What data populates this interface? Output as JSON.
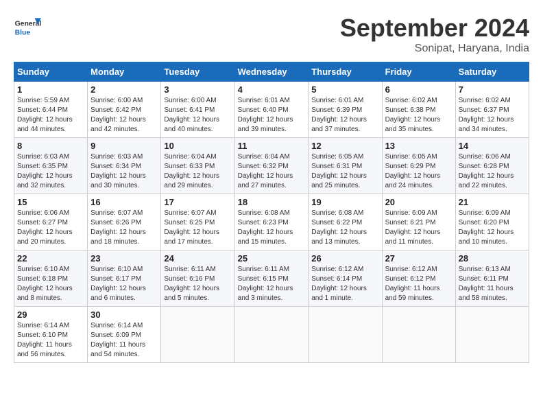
{
  "header": {
    "logo_general": "General",
    "logo_blue": "Blue",
    "month_title": "September 2024",
    "location": "Sonipat, Haryana, India"
  },
  "weekdays": [
    "Sunday",
    "Monday",
    "Tuesday",
    "Wednesday",
    "Thursday",
    "Friday",
    "Saturday"
  ],
  "weeks": [
    [
      {
        "day": "1",
        "sunrise": "Sunrise: 5:59 AM",
        "sunset": "Sunset: 6:44 PM",
        "daylight": "Daylight: 12 hours and 44 minutes."
      },
      {
        "day": "2",
        "sunrise": "Sunrise: 6:00 AM",
        "sunset": "Sunset: 6:42 PM",
        "daylight": "Daylight: 12 hours and 42 minutes."
      },
      {
        "day": "3",
        "sunrise": "Sunrise: 6:00 AM",
        "sunset": "Sunset: 6:41 PM",
        "daylight": "Daylight: 12 hours and 40 minutes."
      },
      {
        "day": "4",
        "sunrise": "Sunrise: 6:01 AM",
        "sunset": "Sunset: 6:40 PM",
        "daylight": "Daylight: 12 hours and 39 minutes."
      },
      {
        "day": "5",
        "sunrise": "Sunrise: 6:01 AM",
        "sunset": "Sunset: 6:39 PM",
        "daylight": "Daylight: 12 hours and 37 minutes."
      },
      {
        "day": "6",
        "sunrise": "Sunrise: 6:02 AM",
        "sunset": "Sunset: 6:38 PM",
        "daylight": "Daylight: 12 hours and 35 minutes."
      },
      {
        "day": "7",
        "sunrise": "Sunrise: 6:02 AM",
        "sunset": "Sunset: 6:37 PM",
        "daylight": "Daylight: 12 hours and 34 minutes."
      }
    ],
    [
      {
        "day": "8",
        "sunrise": "Sunrise: 6:03 AM",
        "sunset": "Sunset: 6:35 PM",
        "daylight": "Daylight: 12 hours and 32 minutes."
      },
      {
        "day": "9",
        "sunrise": "Sunrise: 6:03 AM",
        "sunset": "Sunset: 6:34 PM",
        "daylight": "Daylight: 12 hours and 30 minutes."
      },
      {
        "day": "10",
        "sunrise": "Sunrise: 6:04 AM",
        "sunset": "Sunset: 6:33 PM",
        "daylight": "Daylight: 12 hours and 29 minutes."
      },
      {
        "day": "11",
        "sunrise": "Sunrise: 6:04 AM",
        "sunset": "Sunset: 6:32 PM",
        "daylight": "Daylight: 12 hours and 27 minutes."
      },
      {
        "day": "12",
        "sunrise": "Sunrise: 6:05 AM",
        "sunset": "Sunset: 6:31 PM",
        "daylight": "Daylight: 12 hours and 25 minutes."
      },
      {
        "day": "13",
        "sunrise": "Sunrise: 6:05 AM",
        "sunset": "Sunset: 6:29 PM",
        "daylight": "Daylight: 12 hours and 24 minutes."
      },
      {
        "day": "14",
        "sunrise": "Sunrise: 6:06 AM",
        "sunset": "Sunset: 6:28 PM",
        "daylight": "Daylight: 12 hours and 22 minutes."
      }
    ],
    [
      {
        "day": "15",
        "sunrise": "Sunrise: 6:06 AM",
        "sunset": "Sunset: 6:27 PM",
        "daylight": "Daylight: 12 hours and 20 minutes."
      },
      {
        "day": "16",
        "sunrise": "Sunrise: 6:07 AM",
        "sunset": "Sunset: 6:26 PM",
        "daylight": "Daylight: 12 hours and 18 minutes."
      },
      {
        "day": "17",
        "sunrise": "Sunrise: 6:07 AM",
        "sunset": "Sunset: 6:25 PM",
        "daylight": "Daylight: 12 hours and 17 minutes."
      },
      {
        "day": "18",
        "sunrise": "Sunrise: 6:08 AM",
        "sunset": "Sunset: 6:23 PM",
        "daylight": "Daylight: 12 hours and 15 minutes."
      },
      {
        "day": "19",
        "sunrise": "Sunrise: 6:08 AM",
        "sunset": "Sunset: 6:22 PM",
        "daylight": "Daylight: 12 hours and 13 minutes."
      },
      {
        "day": "20",
        "sunrise": "Sunrise: 6:09 AM",
        "sunset": "Sunset: 6:21 PM",
        "daylight": "Daylight: 12 hours and 11 minutes."
      },
      {
        "day": "21",
        "sunrise": "Sunrise: 6:09 AM",
        "sunset": "Sunset: 6:20 PM",
        "daylight": "Daylight: 12 hours and 10 minutes."
      }
    ],
    [
      {
        "day": "22",
        "sunrise": "Sunrise: 6:10 AM",
        "sunset": "Sunset: 6:18 PM",
        "daylight": "Daylight: 12 hours and 8 minutes."
      },
      {
        "day": "23",
        "sunrise": "Sunrise: 6:10 AM",
        "sunset": "Sunset: 6:17 PM",
        "daylight": "Daylight: 12 hours and 6 minutes."
      },
      {
        "day": "24",
        "sunrise": "Sunrise: 6:11 AM",
        "sunset": "Sunset: 6:16 PM",
        "daylight": "Daylight: 12 hours and 5 minutes."
      },
      {
        "day": "25",
        "sunrise": "Sunrise: 6:11 AM",
        "sunset": "Sunset: 6:15 PM",
        "daylight": "Daylight: 12 hours and 3 minutes."
      },
      {
        "day": "26",
        "sunrise": "Sunrise: 6:12 AM",
        "sunset": "Sunset: 6:14 PM",
        "daylight": "Daylight: 12 hours and 1 minute."
      },
      {
        "day": "27",
        "sunrise": "Sunrise: 6:12 AM",
        "sunset": "Sunset: 6:12 PM",
        "daylight": "Daylight: 11 hours and 59 minutes."
      },
      {
        "day": "28",
        "sunrise": "Sunrise: 6:13 AM",
        "sunset": "Sunset: 6:11 PM",
        "daylight": "Daylight: 11 hours and 58 minutes."
      }
    ],
    [
      {
        "day": "29",
        "sunrise": "Sunrise: 6:14 AM",
        "sunset": "Sunset: 6:10 PM",
        "daylight": "Daylight: 11 hours and 56 minutes."
      },
      {
        "day": "30",
        "sunrise": "Sunrise: 6:14 AM",
        "sunset": "Sunset: 6:09 PM",
        "daylight": "Daylight: 11 hours and 54 minutes."
      },
      null,
      null,
      null,
      null,
      null
    ]
  ]
}
